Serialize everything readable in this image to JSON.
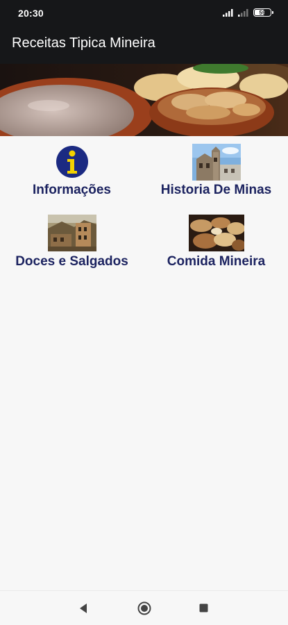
{
  "status_bar": {
    "time": "20:30",
    "battery_level": "59",
    "icons": [
      "signal-strong-icon",
      "signal-weak-icon",
      "battery-icon"
    ]
  },
  "app_bar": {
    "title": "Receitas Tipica Mineira"
  },
  "menu": {
    "items": [
      {
        "label": "Informações",
        "icon": "info-icon"
      },
      {
        "label": "Historia De Minas",
        "icon": "church-photo"
      },
      {
        "label": "Doces e Salgados",
        "icon": "town-photo"
      },
      {
        "label": "Comida Mineira",
        "icon": "food-photo"
      }
    ]
  },
  "nav_bar": {
    "buttons": [
      "back-icon",
      "home-icon",
      "recents-icon"
    ]
  },
  "colors": {
    "bar": "#161719",
    "label": "#1c2360",
    "background": "#f7f7f7",
    "info_icon": "#1b2a82",
    "info_glyph": "#f3d200"
  }
}
